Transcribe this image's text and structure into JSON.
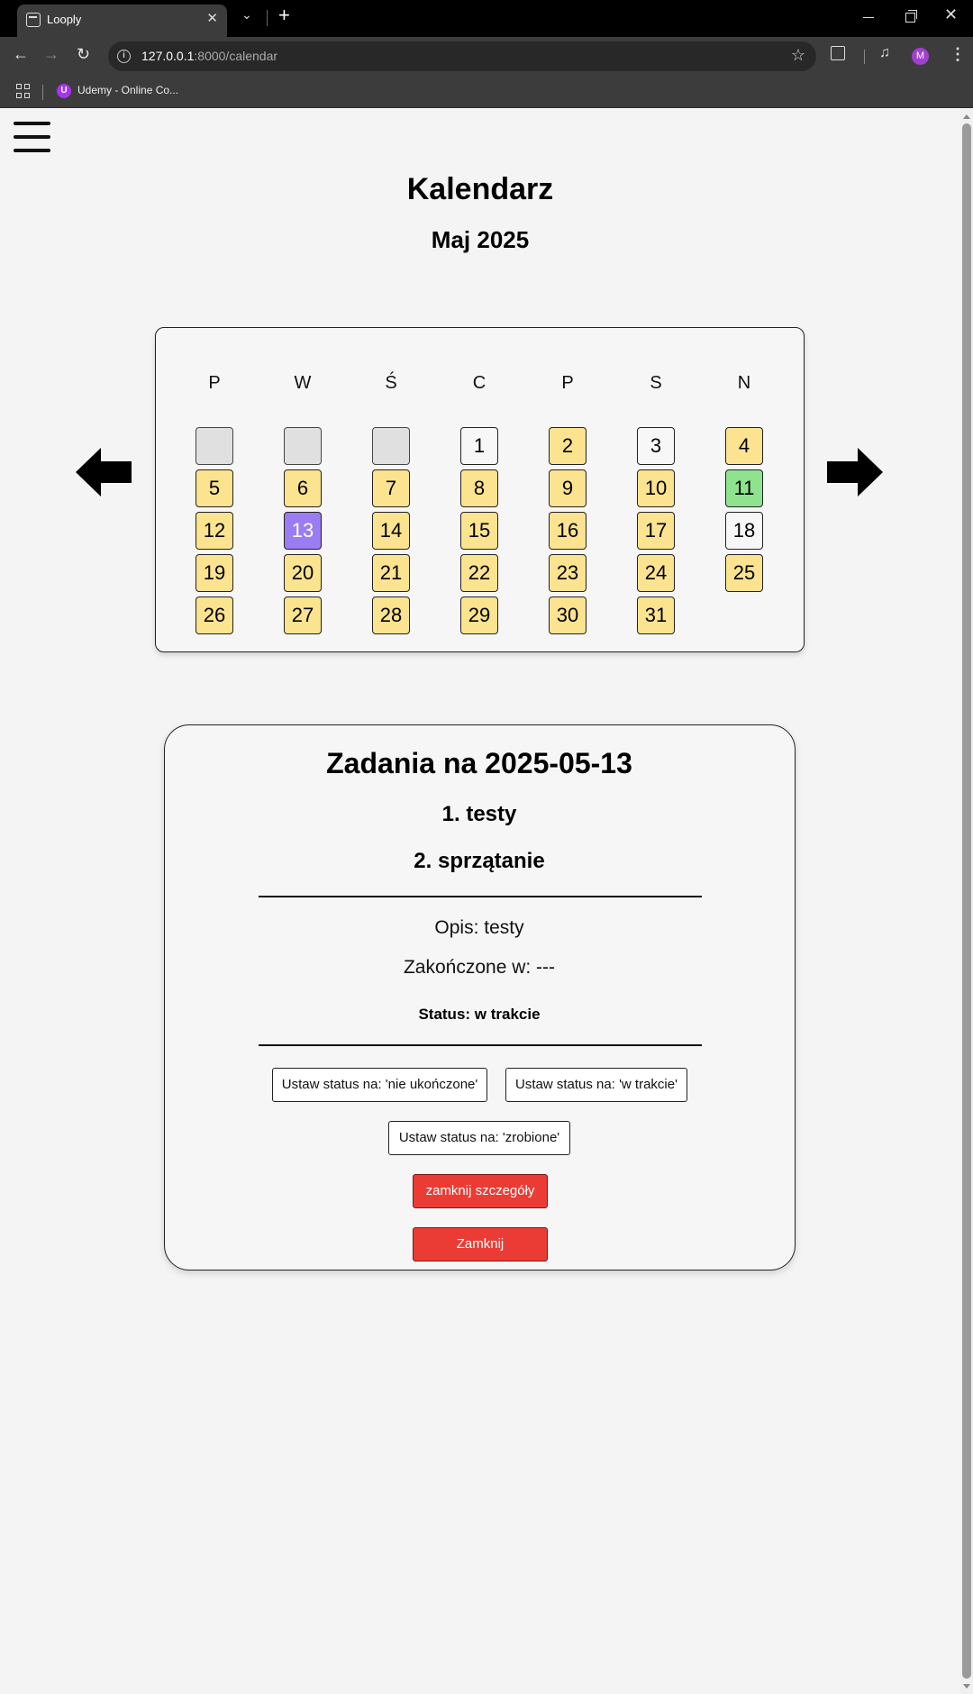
{
  "browser": {
    "tab_title": "Looply",
    "url_host": "127.0.0.1",
    "url_path": ":8000/calendar",
    "bookmark_label": "Udemy - Online Co...",
    "profile_initial": "M"
  },
  "page": {
    "title": "Kalendarz",
    "month": "Maj 2025"
  },
  "calendar": {
    "weekdays": [
      "P",
      "W",
      "Ś",
      "C",
      "P",
      "S",
      "N"
    ],
    "leading_empty": 3,
    "days": [
      {
        "n": "1",
        "s": "none"
      },
      {
        "n": "2",
        "s": "pending"
      },
      {
        "n": "3",
        "s": "none"
      },
      {
        "n": "4",
        "s": "pending"
      },
      {
        "n": "5",
        "s": "pending"
      },
      {
        "n": "6",
        "s": "pending"
      },
      {
        "n": "7",
        "s": "pending"
      },
      {
        "n": "8",
        "s": "pending"
      },
      {
        "n": "9",
        "s": "pending"
      },
      {
        "n": "10",
        "s": "pending"
      },
      {
        "n": "11",
        "s": "done"
      },
      {
        "n": "12",
        "s": "pending"
      },
      {
        "n": "13",
        "s": "selected"
      },
      {
        "n": "14",
        "s": "pending"
      },
      {
        "n": "15",
        "s": "pending"
      },
      {
        "n": "16",
        "s": "pending"
      },
      {
        "n": "17",
        "s": "pending"
      },
      {
        "n": "18",
        "s": "none"
      },
      {
        "n": "19",
        "s": "pending"
      },
      {
        "n": "20",
        "s": "pending"
      },
      {
        "n": "21",
        "s": "pending"
      },
      {
        "n": "22",
        "s": "pending"
      },
      {
        "n": "23",
        "s": "pending"
      },
      {
        "n": "24",
        "s": "pending"
      },
      {
        "n": "25",
        "s": "pending"
      },
      {
        "n": "26",
        "s": "pending"
      },
      {
        "n": "27",
        "s": "pending"
      },
      {
        "n": "28",
        "s": "pending"
      },
      {
        "n": "29",
        "s": "pending"
      },
      {
        "n": "30",
        "s": "pending"
      },
      {
        "n": "31",
        "s": "pending"
      }
    ]
  },
  "tasks": {
    "title": "Zadania na 2025-05-13",
    "items": [
      "1. testy",
      "2. sprzątanie"
    ],
    "description": "Opis: testy",
    "completed_at": "Zakończone w: ---",
    "status": "Status: w trakcie",
    "btn_not_done": "Ustaw status na: 'nie ukończone'",
    "btn_in_progress": "Ustaw status na: 'w trakcie'",
    "btn_done": "Ustaw status na: 'zrobione'",
    "btn_close_details": "zamknij szczegóły",
    "btn_close": "Zamknij"
  },
  "colors": {
    "pending": "#fbe38f",
    "done": "#8fe38f",
    "selected": "#9b7cf2",
    "empty": "#e0e0e0",
    "danger": "#ea3c35"
  }
}
